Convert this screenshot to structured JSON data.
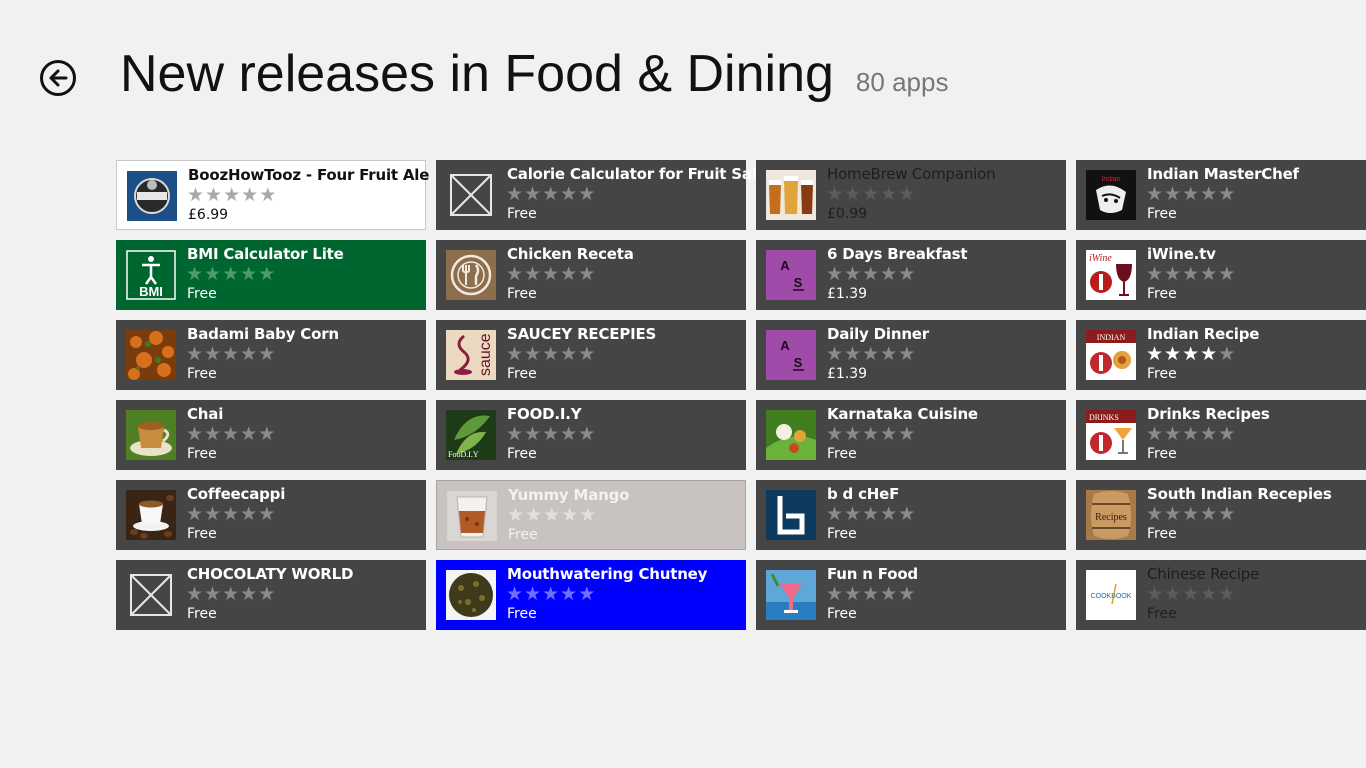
{
  "header": {
    "back_label": "Back",
    "title": "New releases in Food & Dining",
    "count": "80 apps"
  },
  "colors": {
    "background": "#f1f1f1",
    "tile_default": "#454545",
    "tile_white": "#ffffff",
    "tile_green": "#00662f",
    "tile_blue": "#0000ff",
    "tile_silver": "#c8c3c0",
    "star_filled": "#ffffff",
    "star_empty": "#8a8a8a"
  },
  "apps": [
    {
      "name": "BoozHowTooz - Four Fruit Ale",
      "price": "£6.99",
      "rating": 0,
      "style": "white",
      "icon": "beer-label-icon"
    },
    {
      "name": "BMI Calculator Lite",
      "price": "Free",
      "rating": 0,
      "style": "green",
      "icon": "bmi-person-icon",
      "icon_text": "BMI"
    },
    {
      "name": "Badami Baby Corn",
      "price": "Free",
      "rating": 0,
      "style": "default",
      "icon": "baby-corn-dish-icon"
    },
    {
      "name": "Chai",
      "price": "Free",
      "rating": 0,
      "style": "default",
      "icon": "chai-cup-icon"
    },
    {
      "name": "Coffeecappi",
      "price": "Free",
      "rating": 0,
      "style": "default",
      "icon": "coffee-cup-icon"
    },
    {
      "name": "CHOCOLATY WORLD",
      "price": "Free",
      "rating": 0,
      "style": "default",
      "icon": "missing-image-icon"
    },
    {
      "name": "Calorie Calculator for Fruit Salad",
      "price": "Free",
      "rating": 0,
      "style": "default",
      "icon": "missing-image-icon"
    },
    {
      "name": "Chicken Receta",
      "price": "Free",
      "rating": 0,
      "style": "default",
      "icon": "plate-fork-knife-icon"
    },
    {
      "name": "SAUCEY RECEPIES",
      "price": "Free",
      "rating": 0,
      "style": "default",
      "icon": "sauce-logo-icon",
      "icon_text": "sauce"
    },
    {
      "name": "FOOD.I.Y",
      "price": "Free",
      "rating": 0,
      "style": "default",
      "icon": "herb-leaves-icon",
      "icon_text": "FooD.I.Y"
    },
    {
      "name": "Yummy Mango",
      "price": "Free",
      "rating": 0,
      "style": "silver",
      "icon": "mango-glass-icon"
    },
    {
      "name": "Mouthwatering Chutney",
      "price": "Free",
      "rating": 0,
      "style": "blue",
      "icon": "chutney-plate-icon"
    },
    {
      "name": "HomeBrew Companion",
      "price": "£0.99",
      "rating": 0,
      "style": "darkmuted",
      "icon": "beer-glasses-icon"
    },
    {
      "name": "6 Days Breakfast",
      "price": "£1.39",
      "rating": 0,
      "style": "default",
      "icon": "purple-as-logo-icon",
      "icon_text": "A S"
    },
    {
      "name": "Daily Dinner",
      "price": "£1.39",
      "rating": 0,
      "style": "default",
      "icon": "purple-as-logo-icon",
      "icon_text": "A S"
    },
    {
      "name": "Karnataka Cuisine",
      "price": "Free",
      "rating": 0,
      "style": "default",
      "icon": "banana-leaf-meal-icon"
    },
    {
      "name": "b d cHeF",
      "price": "Free",
      "rating": 0,
      "style": "default",
      "icon": "bd-chef-logo-icon"
    },
    {
      "name": "Fun n Food",
      "price": "Free",
      "rating": 0,
      "style": "default",
      "icon": "beach-cocktail-icon"
    },
    {
      "name": "Indian MasterChef",
      "price": "Free",
      "rating": 0,
      "style": "default",
      "icon": "masterchef-logo-icon"
    },
    {
      "name": "iWine.tv",
      "price": "Free",
      "rating": 0,
      "style": "default",
      "icon": "wine-glass-logo-icon",
      "icon_text": "iWine"
    },
    {
      "name": "Indian Recipe",
      "price": "Free",
      "rating": 4,
      "style": "default",
      "icon": "indian-food-logo-icon",
      "icon_text": "INDIAN"
    },
    {
      "name": "Drinks Recipes",
      "price": "Free",
      "rating": 0,
      "style": "default",
      "icon": "drinks-logo-icon",
      "icon_text": "DRINKS"
    },
    {
      "name": "South Indian Recepies",
      "price": "Free",
      "rating": 0,
      "style": "default",
      "icon": "recipes-barrel-icon",
      "icon_text": "Recipes"
    },
    {
      "name": "Chinese Recipe",
      "price": "Free",
      "rating": 0,
      "style": "darkmuted",
      "icon": "cookbook-logo-icon",
      "icon_text": "COOKBOOK"
    }
  ]
}
